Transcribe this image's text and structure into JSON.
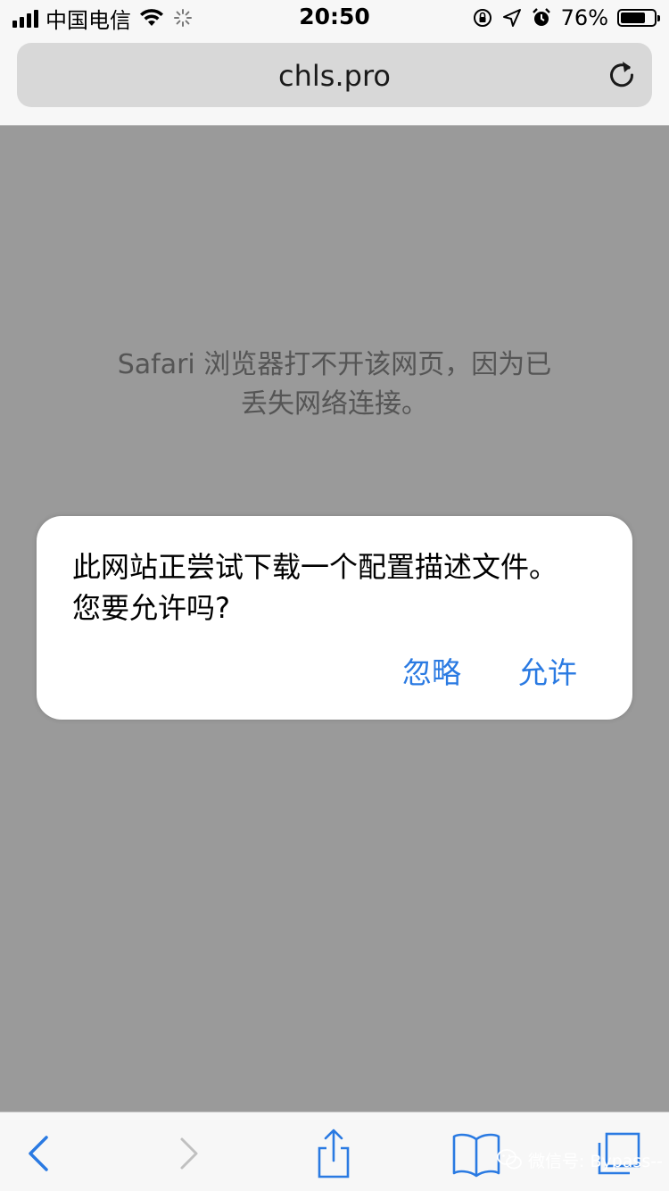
{
  "status_bar": {
    "carrier": "中国电信",
    "time": "20:50",
    "battery_percent": "76%",
    "battery_level": 0.76,
    "icons": [
      "signal-icon",
      "wifi-icon",
      "loading-icon",
      "orientation-lock-icon",
      "location-icon",
      "alarm-icon",
      "battery-icon"
    ]
  },
  "browser": {
    "url": "chls.pro",
    "reload_icon": "reload-icon"
  },
  "page": {
    "error_line1": "Safari 浏览器打不开该网页，因为已",
    "error_line2": "丢失网络连接。"
  },
  "alert": {
    "message_line1": "此网站正尝试下载一个配置描述文件。",
    "message_line2": "您要允许吗?",
    "ignore_label": "忽略",
    "allow_label": "允许",
    "button_color": "#2a7ae2"
  },
  "toolbar": {
    "icons": [
      "back-icon",
      "forward-icon",
      "share-icon",
      "bookmarks-icon",
      "tabs-icon"
    ]
  },
  "watermark": {
    "text": "微信号: Bypass--"
  },
  "colors": {
    "accent": "#2a7ae2",
    "content_bg": "#9a9a9a",
    "bar_bg": "#f7f7f7"
  }
}
